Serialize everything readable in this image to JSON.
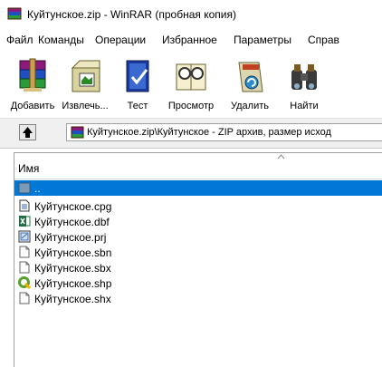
{
  "window": {
    "title": "Куйтунское.zip - WinRAR (пробная копия)"
  },
  "menu": [
    "Файл",
    "Команды",
    "Операции",
    "Избранное",
    "Параметры",
    "Справ"
  ],
  "toolbar": {
    "add": "Добавить",
    "extract": "Извлечь...",
    "test": "Тест",
    "view": "Просмотр",
    "delete": "Удалить",
    "find": "Найти"
  },
  "address": {
    "path": "Куйтунское.zip\\Куйтунское - ZIP архив, размер исход"
  },
  "list": {
    "column_name": "Имя",
    "parent": "..",
    "files": [
      "Куйтунское.cpg",
      "Куйтунское.dbf",
      "Куйтунское.prj",
      "Куйтунское.sbn",
      "Куйтунское.sbx",
      "Куйтунское.shp",
      "Куйтунское.shx"
    ]
  },
  "colors": {
    "selection": "#0078d7",
    "text": "#000000"
  }
}
